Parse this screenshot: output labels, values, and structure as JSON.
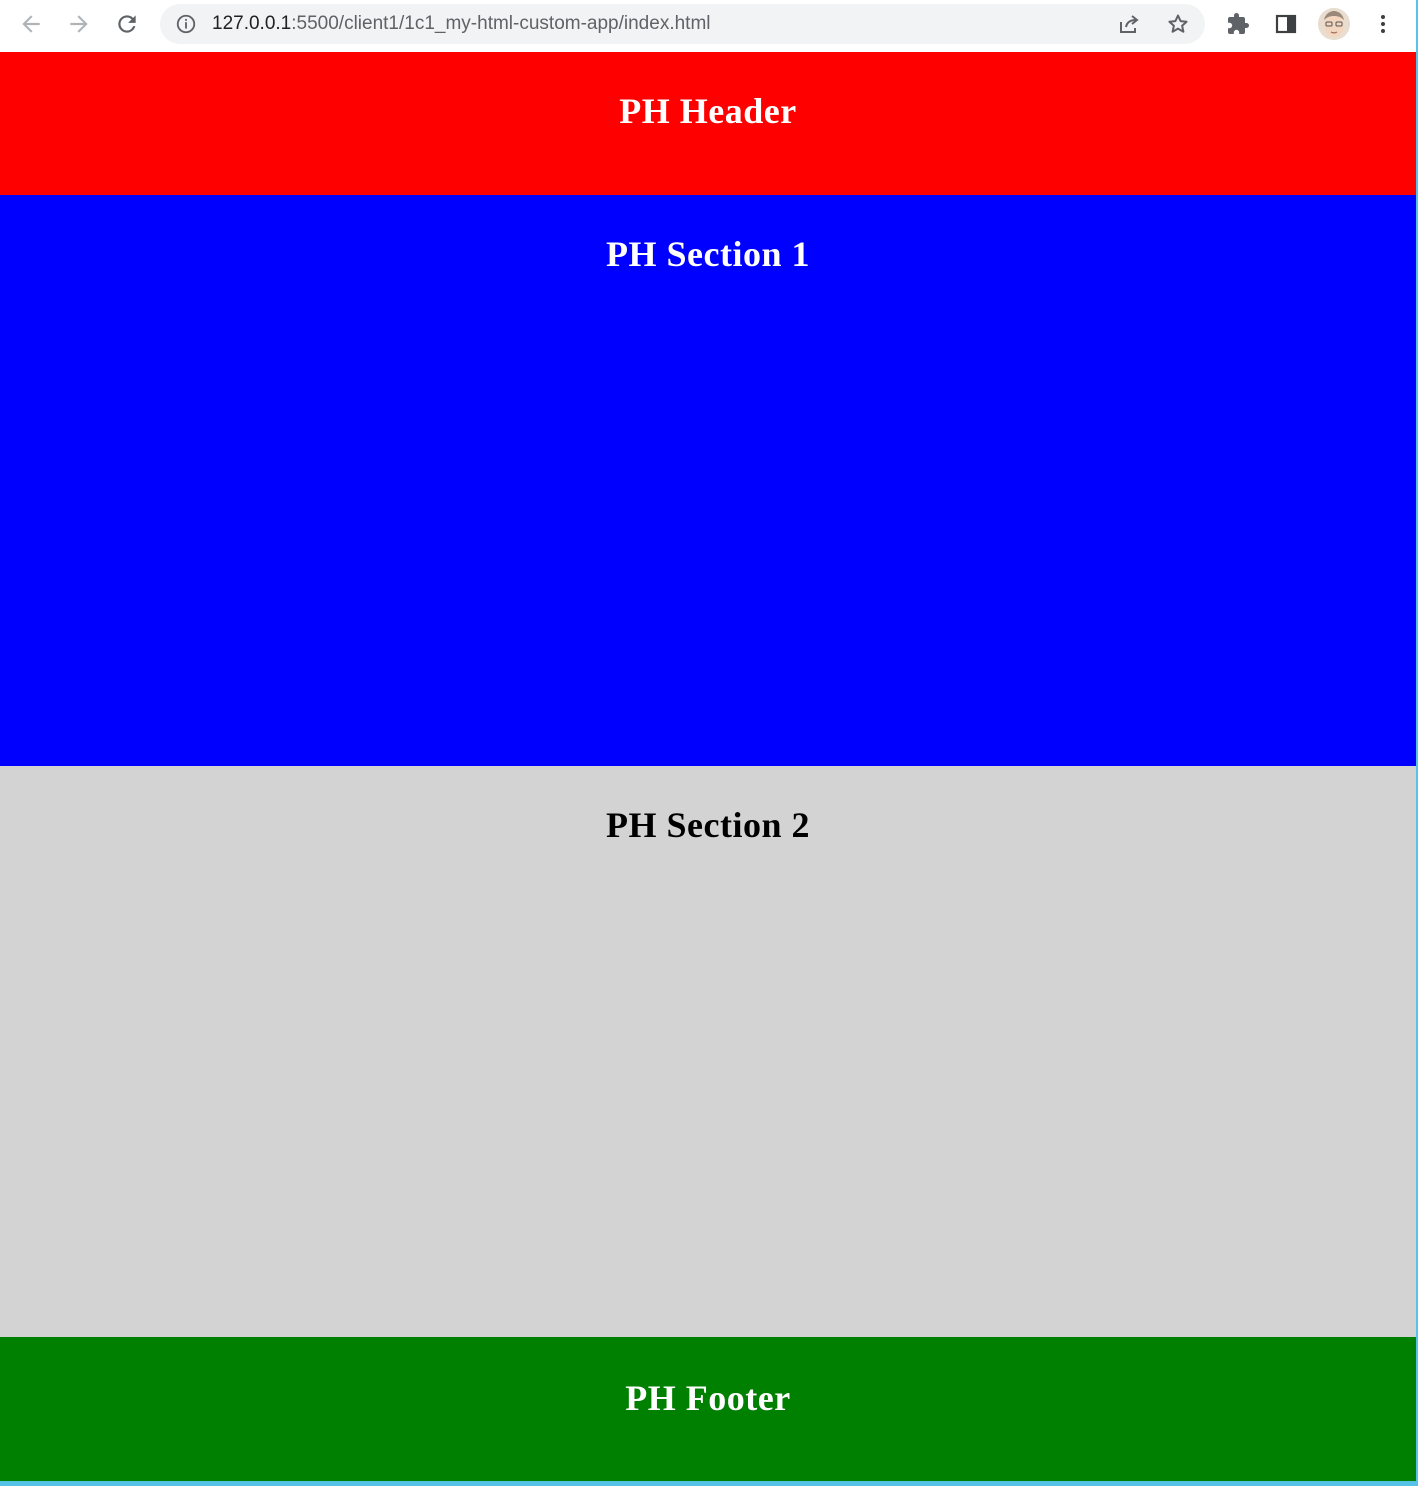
{
  "browser": {
    "url_host": "127.0.0.1",
    "url_rest": ":5500/client1/1c1_my-html-custom-app/index.html"
  },
  "page": {
    "header_title": "PH Header",
    "section1_title": "PH Section 1",
    "section2_title": "PH Section 2",
    "footer_title": "PH Footer"
  },
  "colors": {
    "header_bg": "#ff0000",
    "section1_bg": "#0000ff",
    "section2_bg": "#d3d3d3",
    "footer_bg": "#008000"
  },
  "icons": {
    "back": "arrow-left-icon",
    "forward": "arrow-right-icon",
    "reload": "reload-icon",
    "site_info": "info-icon",
    "share": "share-icon",
    "bookmark": "star-icon",
    "extensions": "puzzle-icon",
    "side_panel": "side-panel-icon",
    "profile": "avatar",
    "menu": "kebab-menu-icon"
  }
}
